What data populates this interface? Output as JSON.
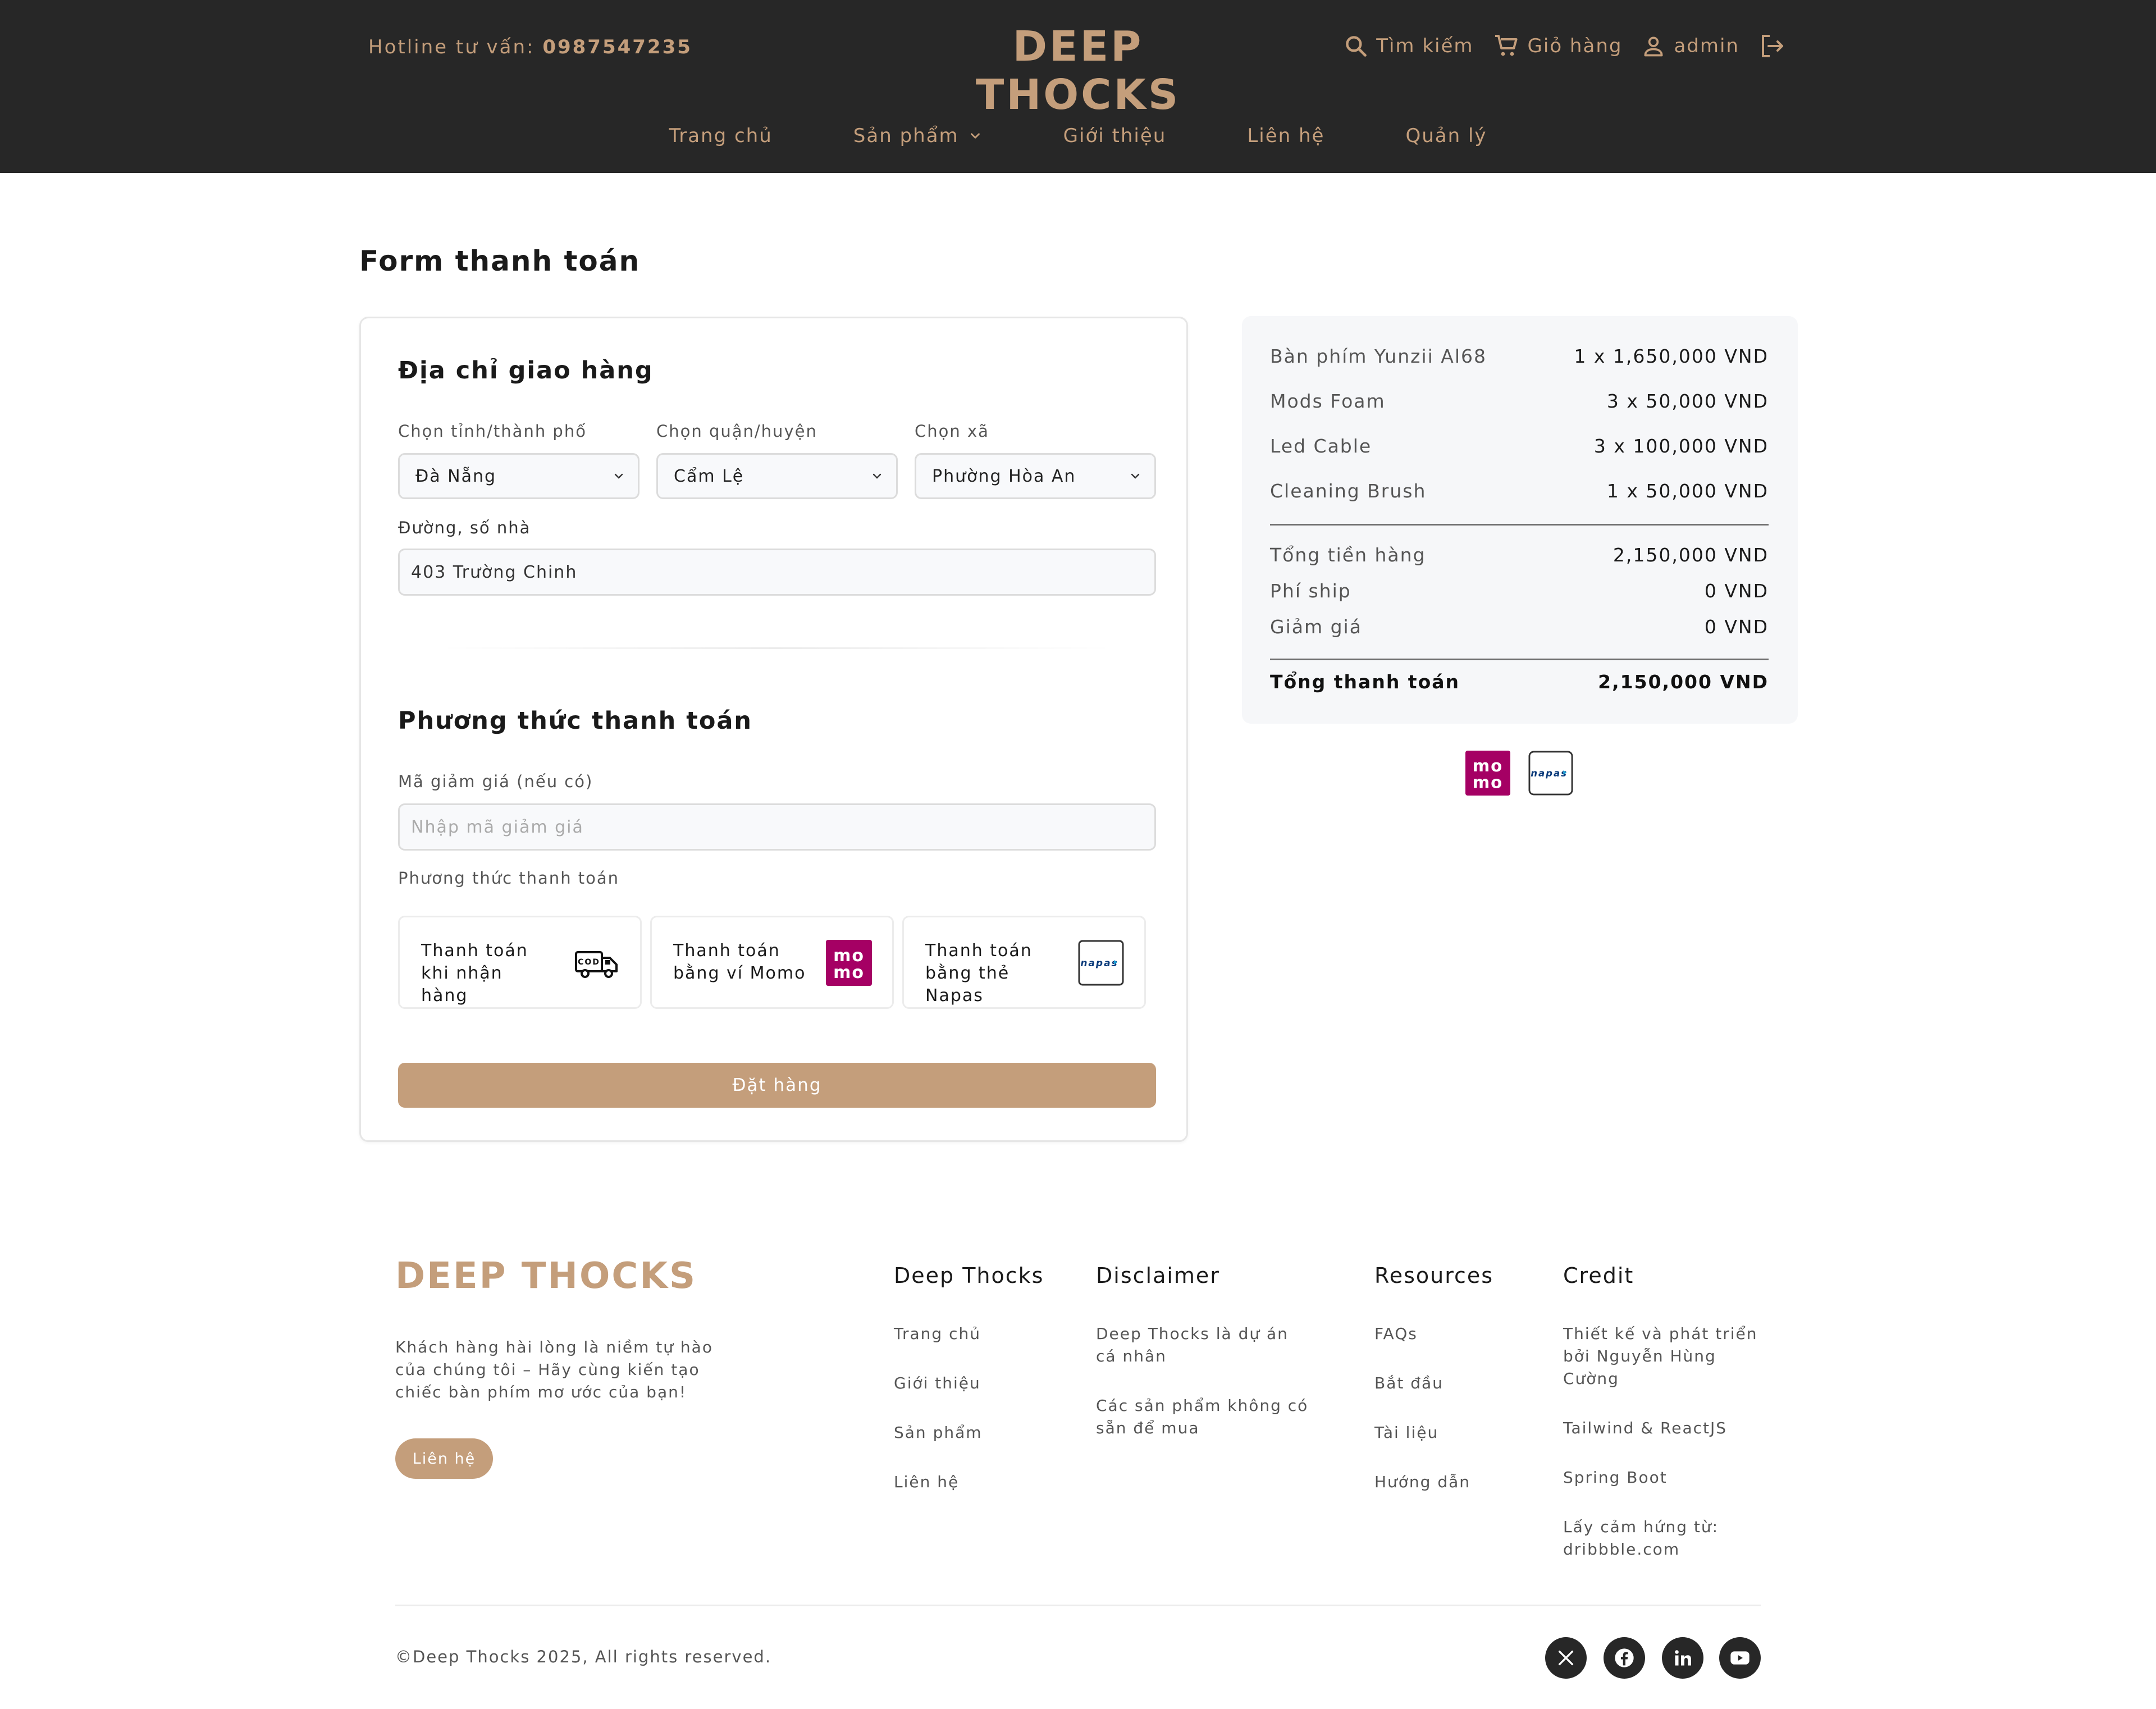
{
  "header": {
    "hotline_label": "Hotline tư vấn: ",
    "hotline_number": "0987547235",
    "brand": "DEEP THOCKS",
    "search_label": "Tìm kiếm",
    "cart_label": "Giỏ hàng",
    "user_label": "admin",
    "nav": [
      "Trang chủ",
      "Sản phẩm",
      "Giới thiệu",
      "Liên hệ",
      "Quản lý"
    ]
  },
  "page_title": "Form thanh toán",
  "shipping": {
    "heading": "Địa chỉ giao hàng",
    "province_label": "Chọn tỉnh/thành phố",
    "province_value": "Đà Nẵng",
    "district_label": "Chọn quận/huyện",
    "district_value": "Cẩm Lệ",
    "ward_label": "Chọn xã",
    "ward_value": "Phường Hòa An",
    "street_label": "Đường, số nhà",
    "street_value": "403 Trường Chinh"
  },
  "payment": {
    "heading": "Phương thức thanh toán",
    "discount_label": "Mã giảm giá (nếu có)",
    "discount_placeholder": "Nhập mã giảm giá",
    "method_label": "Phương thức thanh toán",
    "methods": [
      {
        "label": "Thanh toán khi nhận hàng",
        "icon": "cod-truck-icon"
      },
      {
        "label": "Thanh toán bằng ví Momo",
        "icon": "momo-logo-icon"
      },
      {
        "label": "Thanh toán bằng thẻ Napas",
        "icon": "napas-logo-icon"
      }
    ],
    "submit_label": "Đặt hàng"
  },
  "summary": {
    "items": [
      {
        "name": "Bàn phím Yunzii Al68",
        "qty_price": "1 x 1,650,000 VND"
      },
      {
        "name": "Mods Foam",
        "qty_price": "3 x 50,000 VND"
      },
      {
        "name": "Led Cable",
        "qty_price": "3 x 100,000 VND"
      },
      {
        "name": "Cleaning Brush",
        "qty_price": "1 x 50,000 VND"
      }
    ],
    "subtotal_label": "Tổng tiền hàng",
    "subtotal_value": "2,150,000 VND",
    "shipping_label": "Phí ship",
    "shipping_value": "0 VND",
    "discount_label": "Giảm giá",
    "discount_value": "0 VND",
    "total_label": "Tổng thanh toán",
    "total_value": "2,150,000 VND",
    "payment_logos": [
      "momo-logo-icon",
      "napas-logo-icon"
    ]
  },
  "footer": {
    "brand": "DEEP THOCKS",
    "description": "Khách hàng hài lòng là niềm tự hào của chúng tôi – Hãy cùng kiến tạo chiếc bàn phím mơ ước của bạn!",
    "contact_button": "Liên hệ",
    "columns": [
      {
        "title": "Deep Thocks",
        "links": [
          "Trang chủ",
          "Giới thiệu",
          "Sản phẩm",
          "Liên hệ"
        ]
      },
      {
        "title": "Disclaimer",
        "links": [
          "Deep Thocks là dự án cá nhân",
          "Các sản phẩm không có sẵn để mua"
        ]
      },
      {
        "title": "Resources",
        "links": [
          "FAQs",
          "Bắt đầu",
          "Tài liệu",
          "Hướng dẫn"
        ]
      },
      {
        "title": "Credit",
        "links": [
          "Thiết kế và phát triển bởi Nguyễn Hùng Cường",
          "Tailwind & ReactJS",
          "Spring Boot",
          "Lấy cảm hứng từ: dribbble.com"
        ]
      }
    ],
    "copyright": "©Deep Thocks 2025, All rights reserved.",
    "social": [
      "x-icon",
      "facebook-icon",
      "linkedin-icon",
      "youtube-icon"
    ]
  },
  "colors": {
    "header_bg": "#272727",
    "accent": "#c49e7b",
    "momo": "#a50064",
    "summary_bg": "#f6f7f9"
  }
}
